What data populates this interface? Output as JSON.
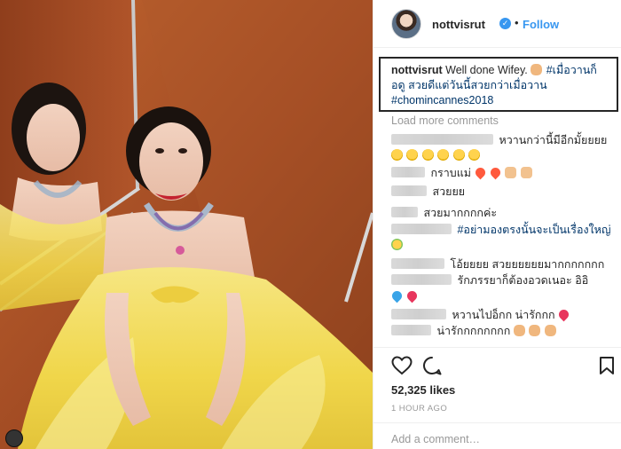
{
  "post": {
    "username": "nottvisrut",
    "verified_icon": "verified-badge-icon",
    "dot": "•",
    "follow_label": "Follow",
    "caption": {
      "username": "nottvisrut",
      "text": "Well done Wifey.",
      "emoji_icon": "ok-hand-emoji-icon",
      "hashtag1": "#เมื่อวานก็อดู สวยดีแต่วันนี้สวยกว่าเมื่อวาน",
      "hashtag2": "#chomincannes2018"
    },
    "load_more": "Load more comments",
    "comments": [
      {
        "text": "หวานกว่านี้มีอีกมั้ยยยย",
        "emojis": []
      },
      {
        "text": "",
        "emojis": [
          "sad-face-emoji-icon",
          "sad-face-emoji-icon",
          "sad-face-emoji-icon",
          "sad-face-emoji-icon",
          "sad-face-emoji-icon",
          "sad-face-emoji-icon"
        ]
      },
      {
        "text": "กราบแม่",
        "emojis": [
          "heart-eyes-emoji-icon",
          "heart-eyes-emoji-icon",
          "pray-emoji-icon",
          "pray-emoji-icon"
        ]
      },
      {
        "text": "สวยยย",
        "emojis": []
      },
      {
        "text": "สวยมากกกกค่ะ",
        "emojis": []
      },
      {
        "text": "#อย่ามองตรงนั้นจะเป็นเรื่องใหญ่",
        "emojis": []
      },
      {
        "text": "",
        "emojis": [
          "party-face-emoji-icon"
        ]
      },
      {
        "text": "โอ้ยยยย สวยยยยยยมากกกกกกก",
        "emojis": []
      },
      {
        "text": "รักภรรยาก็ต้องอวดเนอะ อิอิ",
        "emojis": []
      },
      {
        "text": "",
        "emojis": [
          "blue-heart-emoji-icon",
          "red-heart-emoji-icon"
        ]
      },
      {
        "text": "หวานไปอ็กก น่ารักกก",
        "emojis": [
          "heart-emoji-icon"
        ]
      },
      {
        "text": "น่ารักกกกกกกก",
        "emojis": [
          "clap-emoji-icon",
          "clap-emoji-icon",
          "clap-emoji-icon"
        ]
      }
    ],
    "likes": "52,325 likes",
    "time": "1 HOUR AGO",
    "add_comment_placeholder": "Add a comment…",
    "colors": {
      "link_blue": "#3897f0",
      "hashtag": "#003569",
      "gown_yellow": "#f3dd58",
      "wall_copper": "#a34c24"
    }
  }
}
